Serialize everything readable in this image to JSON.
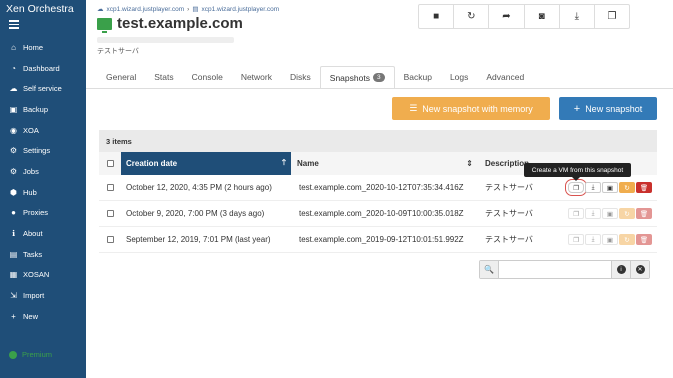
{
  "app": {
    "title": "Xen Orchestra"
  },
  "sidebar": {
    "items": [
      {
        "label": "Home",
        "icon": "home-icon",
        "glyph": "⌂"
      },
      {
        "label": "Dashboard",
        "icon": "dashboard-icon",
        "glyph": "◔"
      },
      {
        "label": "Self service",
        "icon": "cloud-icon",
        "glyph": "☁"
      },
      {
        "label": "Backup",
        "icon": "backup-icon",
        "glyph": "▣"
      },
      {
        "label": "XOA",
        "icon": "xoa-icon",
        "glyph": "◉"
      },
      {
        "label": "Settings",
        "icon": "gear-icon",
        "glyph": "⚙"
      },
      {
        "label": "Jobs",
        "icon": "jobs-icon",
        "glyph": "⚙"
      },
      {
        "label": "Hub",
        "icon": "hub-icon",
        "glyph": "⬢"
      },
      {
        "label": "Proxies",
        "icon": "proxies-icon",
        "glyph": "●"
      },
      {
        "label": "About",
        "icon": "info-icon",
        "glyph": "ℹ"
      },
      {
        "label": "Tasks",
        "icon": "tasks-icon",
        "glyph": "▤"
      },
      {
        "label": "XOSAN",
        "icon": "xosan-icon",
        "glyph": "▦"
      },
      {
        "label": "Import",
        "icon": "import-icon",
        "glyph": "⇲"
      },
      {
        "label": "New",
        "icon": "plus-icon",
        "glyph": "+"
      }
    ],
    "premium": "Premium"
  },
  "breadcrumb": {
    "pool": "xcp1.wizard.justplayer.com",
    "host": "xcp1.wizard.justplayer.com"
  },
  "vm": {
    "name": "test.example.com",
    "description": "テストサーバ"
  },
  "toolbar": {
    "actions": [
      "stop-icon",
      "restart-icon",
      "migrate-icon",
      "snapshot-icon",
      "export-icon",
      "copy-icon"
    ],
    "glyphs": [
      "■",
      "↻",
      "➦",
      "◙",
      "⤓",
      "❐"
    ]
  },
  "tabs": [
    {
      "label": "General"
    },
    {
      "label": "Stats"
    },
    {
      "label": "Console"
    },
    {
      "label": "Network"
    },
    {
      "label": "Disks"
    },
    {
      "label": "Snapshots",
      "badge": "3",
      "active": true
    },
    {
      "label": "Backup"
    },
    {
      "label": "Logs"
    },
    {
      "label": "Advanced"
    }
  ],
  "buttons": {
    "snapshot_with_memory": "New snapshot with memory",
    "new_snapshot": "New snapshot"
  },
  "table": {
    "count": "3 items",
    "columns": {
      "date": "Creation date",
      "name": "Name",
      "description": "Description"
    },
    "rows": [
      {
        "date": "October 12, 2020, 4:35 PM (2 hours ago)",
        "name": "test.example.com_2020-10-12T07:35:34.416Z",
        "description": "テストサーバ"
      },
      {
        "date": "October 9, 2020, 7:00 PM (3 days ago)",
        "name": "test.example.com_2020-10-09T10:00:35.018Z",
        "description": "テストサーバ"
      },
      {
        "date": "September 12, 2019, 7:01 PM (last year)",
        "name": "test.example.com_2019-09-12T10:01:51.992Z",
        "description": "テストサーバ"
      }
    ]
  },
  "tooltip": "Create a VM from this snapshot",
  "search": {
    "placeholder": ""
  }
}
